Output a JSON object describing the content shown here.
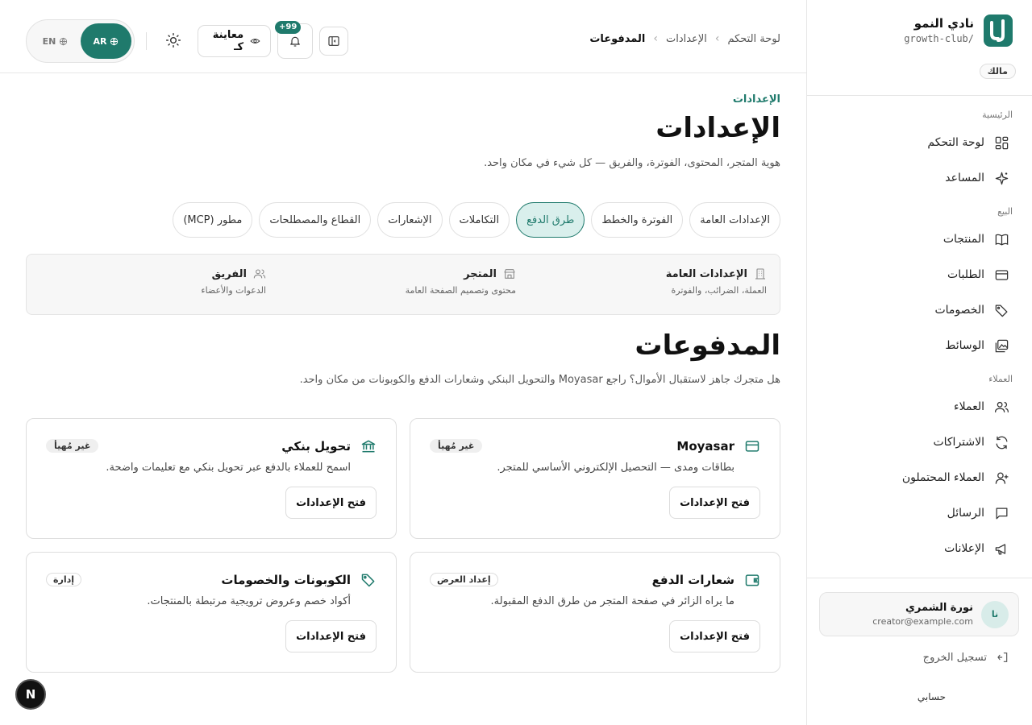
{
  "brand": {
    "name": "نادي النمو",
    "slug": "growth-club/",
    "role": "مالك"
  },
  "sidebar": {
    "sections": [
      {
        "label": "الرئيسية",
        "items": [
          {
            "label": "لوحة التحكم",
            "icon": "dashboard-grid-icon"
          },
          {
            "label": "المساعد",
            "icon": "sparkles-icon"
          }
        ]
      },
      {
        "label": "البيع",
        "items": [
          {
            "label": "المنتجات",
            "icon": "book-icon"
          },
          {
            "label": "الطلبات",
            "icon": "credit-card-icon"
          },
          {
            "label": "الخصومات",
            "icon": "tags-icon"
          },
          {
            "label": "الوسائط",
            "icon": "images-icon"
          }
        ]
      },
      {
        "label": "العملاء",
        "items": [
          {
            "label": "العملاء",
            "icon": "users-icon"
          },
          {
            "label": "الاشتراكات",
            "icon": "refresh-icon"
          },
          {
            "label": "العملاء المحتملون",
            "icon": "user-plus-icon"
          },
          {
            "label": "الرسائل",
            "icon": "message-icon"
          },
          {
            "label": "الإعلانات",
            "icon": "megaphone-icon"
          }
        ]
      }
    ],
    "user": {
      "initials": "نا",
      "name": "نورة الشمري",
      "email": "creator@example.com"
    },
    "logout_label": "تسجيل الخروج",
    "account_label": "حسابي"
  },
  "topbar": {
    "breadcrumb": [
      "لوحة التحكم",
      "الإعدادات",
      "المدفوعات"
    ],
    "notifications_badge": "+99",
    "preview_label": "معاينة كـ",
    "lang": {
      "ar": "AR",
      "en": "EN",
      "active": "AR"
    }
  },
  "page": {
    "eyebrow": "الإعدادات",
    "title": "الإعدادات",
    "subtitle": "هوية المتجر، المحتوى، الفوترة، والفريق — كل شيء في مكان واحد."
  },
  "tabs": [
    {
      "label": "الإعدادات العامة",
      "active": false
    },
    {
      "label": "الفوترة والخطط",
      "active": false
    },
    {
      "label": "طرق الدفع",
      "active": true
    },
    {
      "label": "التكاملات",
      "active": false
    },
    {
      "label": "الإشعارات",
      "active": false
    },
    {
      "label": "القطاع والمصطلحات",
      "active": false
    },
    {
      "label": "مطور (MCP)",
      "active": false
    }
  ],
  "quick_links": [
    {
      "title": "الإعدادات العامة",
      "desc": "العملة، الضرائب، والفوترة",
      "icon": "building-icon"
    },
    {
      "title": "المتجر",
      "desc": "محتوى وتصميم الصفحة العامة",
      "icon": "store-icon"
    },
    {
      "title": "الفريق",
      "desc": "الدعوات والأعضاء",
      "icon": "team-icon"
    }
  ],
  "section": {
    "title": "المدفوعات",
    "subtitle": "هل متجرك جاهز لاستقبال الأموال؟ راجع Moyasar والتحويل البنكي وشعارات الدفع والكوبونات من مكان واحد."
  },
  "cards": [
    {
      "title": "Moyasar",
      "desc": "بطاقات ومدى — التحصيل الإلكتروني الأساسي للمتجر.",
      "badge": "غير مُهيأ",
      "button": "فتح الإعدادات",
      "icon": "credit-card-icon"
    },
    {
      "title": "تحويل بنكي",
      "desc": "اسمح للعملاء بالدفع عبر تحويل بنكي مع تعليمات واضحة.",
      "badge": "غير مُهيأ",
      "button": "فتح الإعدادات",
      "icon": "bank-icon"
    },
    {
      "title": "شعارات الدفع",
      "desc": "ما يراه الزائر في صفحة المتجر من طرق الدفع المقبولة.",
      "badge": "إعداد العرض",
      "button": "فتح الإعدادات",
      "icon": "wallet-icon"
    },
    {
      "title": "الكوبونات والخصومات",
      "desc": "أكواد خصم وعروض ترويجية مرتبطة بالمنتجات.",
      "badge": "إدارة",
      "button": "فتح الإعدادات",
      "icon": "tag-icon"
    }
  ],
  "fab_label": "N",
  "colors": {
    "accent": "#1f7a6c",
    "accent_light": "#d9efec"
  }
}
